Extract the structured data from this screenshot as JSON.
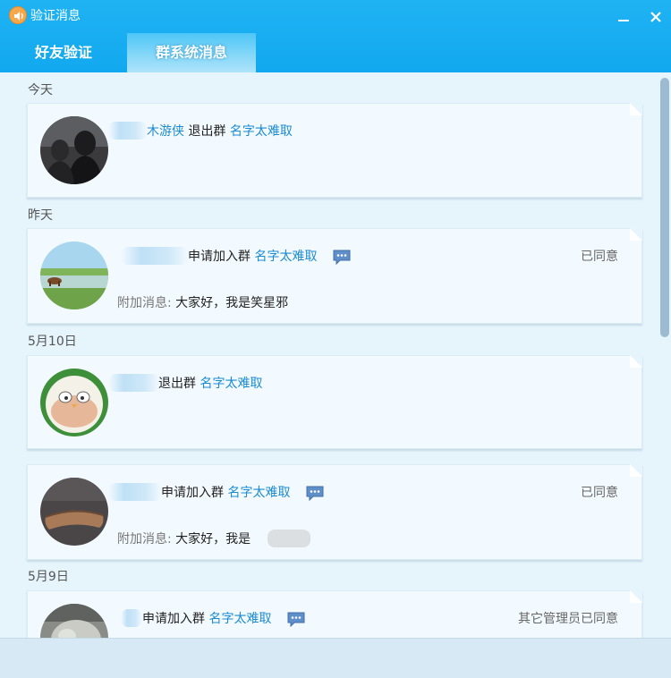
{
  "window": {
    "title": "验证消息"
  },
  "tabs": [
    {
      "label": "好友验证"
    },
    {
      "label": "群系统消息"
    }
  ],
  "colors": {
    "titlebar": "#12a8ef",
    "link": "#1b8bd1",
    "card_bg": "#f3faff"
  },
  "groups": [
    {
      "date": "今天"
    },
    {
      "date": "昨天"
    },
    {
      "date": "5月10日"
    },
    {
      "date": "5月9日"
    }
  ],
  "messages": [
    {
      "user": "木游侠",
      "action": "退出群",
      "group": "名字太难取",
      "status": "",
      "note_label": "",
      "note": ""
    },
    {
      "user": "",
      "action": "申请加入群",
      "group": "名字太难取",
      "status": "已同意",
      "note_label": "附加消息:",
      "note": "大家好，我是笑星邪"
    },
    {
      "user": "",
      "action": "退出群",
      "group": "名字太难取",
      "status": "",
      "note_label": "",
      "note": ""
    },
    {
      "user": "",
      "action": "申请加入群",
      "group": "名字太难取",
      "status": "已同意",
      "note_label": "附加消息:",
      "note": "大家好，我是"
    },
    {
      "user": "",
      "action": "申请加入群",
      "group": "名字太难取",
      "status": "其它管理员已同意",
      "note_label": "",
      "note": ""
    }
  ]
}
